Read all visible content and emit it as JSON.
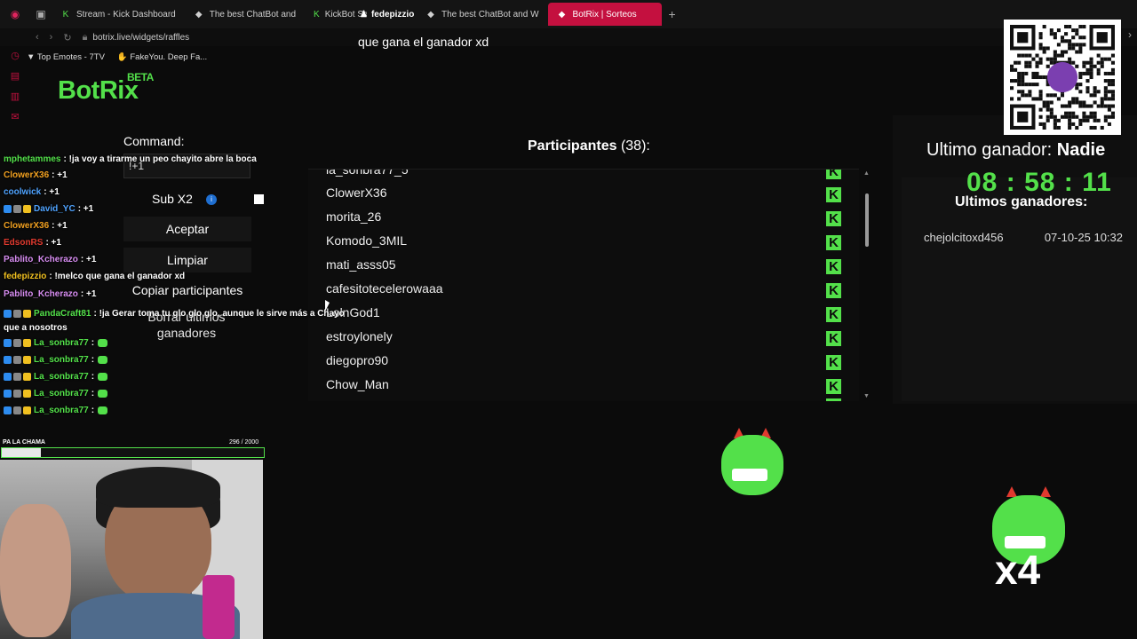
{
  "browser": {
    "tabs": [
      {
        "label": "Stream - Kick Dashboard",
        "icon": "kick-icon",
        "active": false
      },
      {
        "label": "The best ChatBot and",
        "icon": "botrix-icon",
        "active": false
      },
      {
        "label": "KickBot Sav",
        "icon": "kick-icon",
        "active": false
      },
      {
        "label": "The best ChatBot and W",
        "icon": "botrix-icon",
        "active": false
      },
      {
        "label": "BotRix | Sorteos",
        "icon": "botrix-icon",
        "active": true
      }
    ],
    "url": "botrix.live/widgets/raffles",
    "bookmarks": [
      "Top Emotes - 7TV",
      "FakeYou. Deep Fa..."
    ]
  },
  "overlay": {
    "username": "fedepizzio",
    "question": "que gana el ganador xd"
  },
  "logo": {
    "name": "BotRix",
    "badge": "BETA"
  },
  "commands": {
    "label": "Command:",
    "input_value": "!+1",
    "sub_label": "Sub X2",
    "info_icon": "i",
    "accept": "Aceptar",
    "clear": "Limpiar",
    "copy": "Copiar participantes",
    "delete_winners": "Borrar ultimos ganadores"
  },
  "participants": {
    "title": "Participantes",
    "count": "(38):",
    "platform_glyph": "K",
    "list": [
      "la_sonbra77_5",
      "ClowerX36",
      "morita_26",
      "Komodo_3MIL",
      "mati_asss05",
      "cafesitotecelerowaaa",
      "LolnGod1",
      "estroylonely",
      "diegopro90",
      "Chow_Man"
    ]
  },
  "winner": {
    "label": "Ultimo ganador:",
    "name": "Nadie",
    "timer": {
      "h": "08",
      "m": "58",
      "s": "11",
      "sep": ":"
    },
    "recent_label": "Ultimos ganadores:",
    "recent": [
      {
        "name": "chejolcitoxd456",
        "date": "07-10-25 10:32"
      }
    ]
  },
  "chat": [
    {
      "user": "mphetammes",
      "color": "#53e04a",
      "text": ": !ja voy a tirarme un peo chayito abre la boca"
    },
    {
      "user": "ClowerX36",
      "color": "#f0a020",
      "text": ": +1"
    },
    {
      "user": "coolwick",
      "color": "#4fa3ff",
      "text": ": +1"
    },
    {
      "user": "David_YC",
      "color": "#4fa3ff",
      "text": ": +1"
    },
    {
      "user": "ClowerX36",
      "color": "#f0a020",
      "text": ": +1"
    },
    {
      "user": "EdsonRS",
      "color": "#e03a2f",
      "text": ": +1"
    },
    {
      "user": "Pablito_Kcherazo",
      "color": "#d68cf0",
      "text": ": +1"
    },
    {
      "user": "fedepizzio",
      "color": "#f0c020",
      "text": ": !melco que gana el ganador xd"
    },
    {
      "user": "Pablito_Kcherazo",
      "color": "#d68cf0",
      "text": ": +1"
    },
    {
      "user": "PandaCraft81",
      "color": "#53e04a",
      "text": ": !ja Gerar toma tu glo glo glo, aunque le sirve más a Chayo que a nosotros"
    },
    {
      "user": "La_sonbra77",
      "color": "#53e04a",
      "text": ":"
    },
    {
      "user": "La_sonbra77",
      "color": "#53e04a",
      "text": ":"
    },
    {
      "user": "La_sonbra77",
      "color": "#53e04a",
      "text": ":"
    },
    {
      "user": "La_sonbra77",
      "color": "#53e04a",
      "text": ":"
    },
    {
      "user": "La_sonbra77",
      "color": "#53e04a",
      "text": ":"
    }
  ],
  "goal": {
    "label": "PA LA CHAMA",
    "count": "296 / 2000",
    "fraction": 0.148
  },
  "combo": {
    "text": "x4"
  },
  "colors": {
    "accent": "#53e04a",
    "brand": "#c4103f",
    "bg": "#0b0b0b"
  }
}
